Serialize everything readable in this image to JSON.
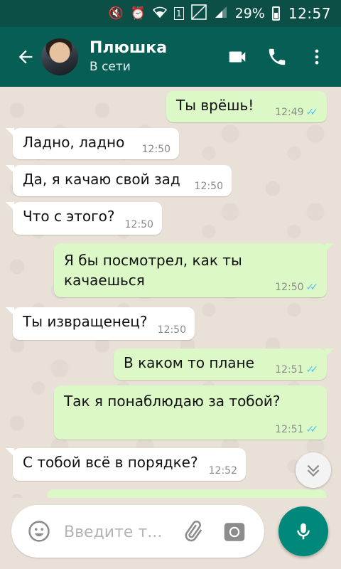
{
  "status_bar": {
    "battery_percent": "29%",
    "time": "12:57",
    "sim": "1"
  },
  "header": {
    "contact_name": "Плюшка",
    "status": "В сети",
    "icons": {
      "back": "arrow-left-icon",
      "video": "video-call-icon",
      "call": "phone-icon",
      "menu": "more-vert-icon"
    }
  },
  "messages": [
    {
      "direction": "out",
      "text": "Ты врёшь!",
      "time": "12:49",
      "read": true
    },
    {
      "direction": "in",
      "text": "Ладно, ладно",
      "time": "12:50"
    },
    {
      "direction": "in",
      "text": "Да, я качаю свой зад",
      "time": "12:50"
    },
    {
      "direction": "in",
      "text": "Что с этого?",
      "time": "12:50"
    },
    {
      "direction": "out",
      "text": "Я бы посмотрел, как ты\nкачаешься",
      "time": "12:50",
      "read": true
    },
    {
      "direction": "in",
      "text": "Ты извращенец?",
      "time": "12:50"
    },
    {
      "direction": "out",
      "text": "В каком то плане",
      "time": "12:51",
      "read": true
    },
    {
      "direction": "out",
      "text": "Так я понаблюдаю за тобой?",
      "time": "12:51",
      "read": true
    },
    {
      "direction": "in",
      "text": "С тобой всё в порядке?",
      "time": "12:52"
    }
  ],
  "input": {
    "placeholder": "Введите т..."
  },
  "colors": {
    "header": "#075e54",
    "statusbar": "#0b4f47",
    "outgoing_bubble": "#dcf8c6",
    "incoming_bubble": "#ffffff",
    "read_ticks": "#4fc3f7",
    "mic_button": "#00897b"
  }
}
